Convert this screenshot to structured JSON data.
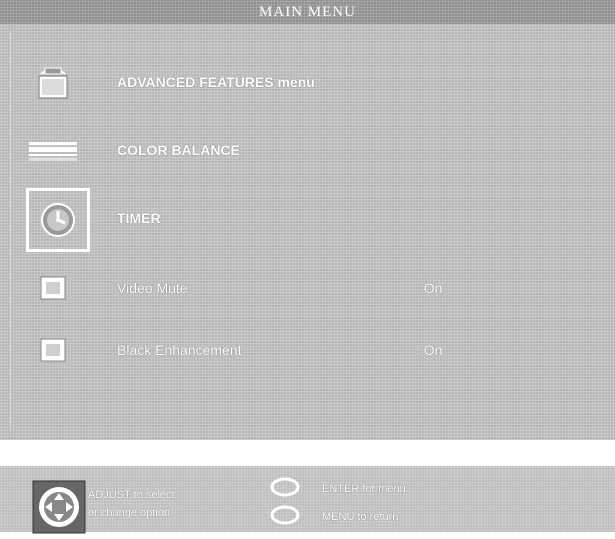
{
  "title": "MAIN MENU",
  "menu_items": [
    {
      "label": "ADVANCED FEATURES menu",
      "value": "",
      "icon": "tv-icon",
      "selected": false
    },
    {
      "label": "COLOR BALANCE",
      "value": "",
      "icon": "color-bars-icon",
      "selected": false
    },
    {
      "label": "TIMER",
      "value": "",
      "icon": "clock-icon",
      "selected": true
    },
    {
      "label": "Video Mute",
      "value": ": On",
      "icon": "checkbox-icon",
      "selected": false
    },
    {
      "label": "Black Enhancement",
      "value": ": On",
      "icon": "checkbox-icon",
      "selected": false
    }
  ],
  "help": {
    "adjust_line1": "ADJUST to select",
    "adjust_line2": "or change option",
    "enter_text": "ENTER for menu",
    "menu_text": "MENU to return"
  }
}
